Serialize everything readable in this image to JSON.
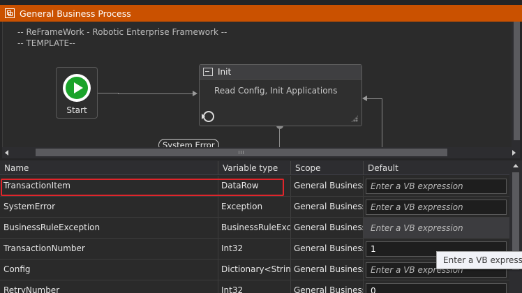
{
  "designer": {
    "title": "General Business Process",
    "annotation_line1": "-- ReFrameWork - Robotic Enterprise Framework --",
    "annotation_line2": "-- TEMPLATE--",
    "start_label": "Start",
    "init_state": {
      "title": "Init",
      "description": "Read Config, Init Applications"
    },
    "transition_label": "System Error"
  },
  "grid": {
    "columns": [
      "Name",
      "Variable type",
      "Scope",
      "Default"
    ],
    "rows": [
      {
        "name": "TransactionItem",
        "type": "DataRow",
        "scope": "General Business",
        "default": "Enter a VB expression"
      },
      {
        "name": "SystemError",
        "type": "Exception",
        "scope": "General Business",
        "default": "Enter a VB expression"
      },
      {
        "name": "BusinessRuleException",
        "type": "BusinessRuleException",
        "scope": "General Business",
        "default": "Enter a VB expression"
      },
      {
        "name": "TransactionNumber",
        "type": "Int32",
        "scope": "General Business",
        "default": "1"
      },
      {
        "name": "Config",
        "type": "Dictionary<String,Object>",
        "scope": "General Business",
        "default": "Enter a VB expression"
      },
      {
        "name": "RetryNumber",
        "type": "Int32",
        "scope": "General Business",
        "default": "0"
      }
    ]
  },
  "tooltip": "Enter a VB expression"
}
